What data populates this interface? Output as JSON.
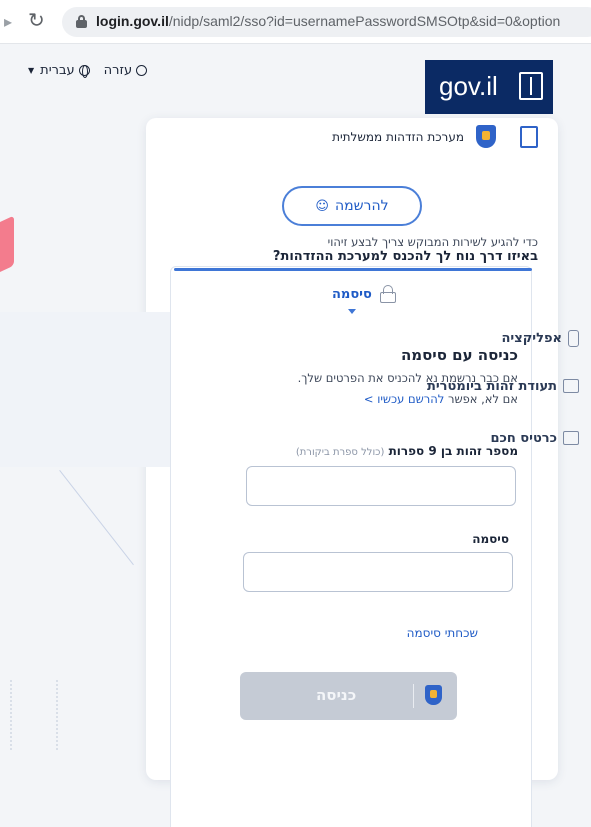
{
  "browser": {
    "url_domain": "login.gov.il",
    "url_path": "/nidp/saml2/sso?id=usernamePasswordSMSOtp&sid=0&option"
  },
  "utility": {
    "language": "עברית",
    "help": "עזרה"
  },
  "logo": {
    "text": "gov.il"
  },
  "card": {
    "system_title": "מערכת הזדהות ממשלתית",
    "register_label": "להרשמה",
    "identify_note": "כדי להגיע לשירות המבוקש צריך לבצע זיהוי",
    "identify_question": "באיזו דרך נוח לך להכנס למערכת ההזדהות?"
  },
  "tabs": [
    {
      "label": "אפליקציה"
    },
    {
      "label": "תעודת זהות ביומטרית"
    },
    {
      "label": "כרטיס חכם"
    }
  ],
  "active_tab": {
    "label": "סיסמה"
  },
  "form": {
    "title": "כניסה עם סיסמה",
    "description": "אם כבר נרשמת נא להכניס את הפרטים שלך.",
    "alt_prefix": "אם לא, אפשר",
    "alt_link": "להרשם עכשיו >",
    "id_label": "מספר זהות בן 9 ספרות",
    "id_hint": "(כולל ספרת ביקורת)",
    "password_label": "סיסמה",
    "forgot_password": "שכחתי סיסמה",
    "login_button": "כניסה"
  },
  "colors": {
    "primary": "#1f5bc6",
    "brand_navy": "#0b2a64",
    "disabled_button": "#c5cbd5",
    "shield_gold": "#f2b233"
  }
}
